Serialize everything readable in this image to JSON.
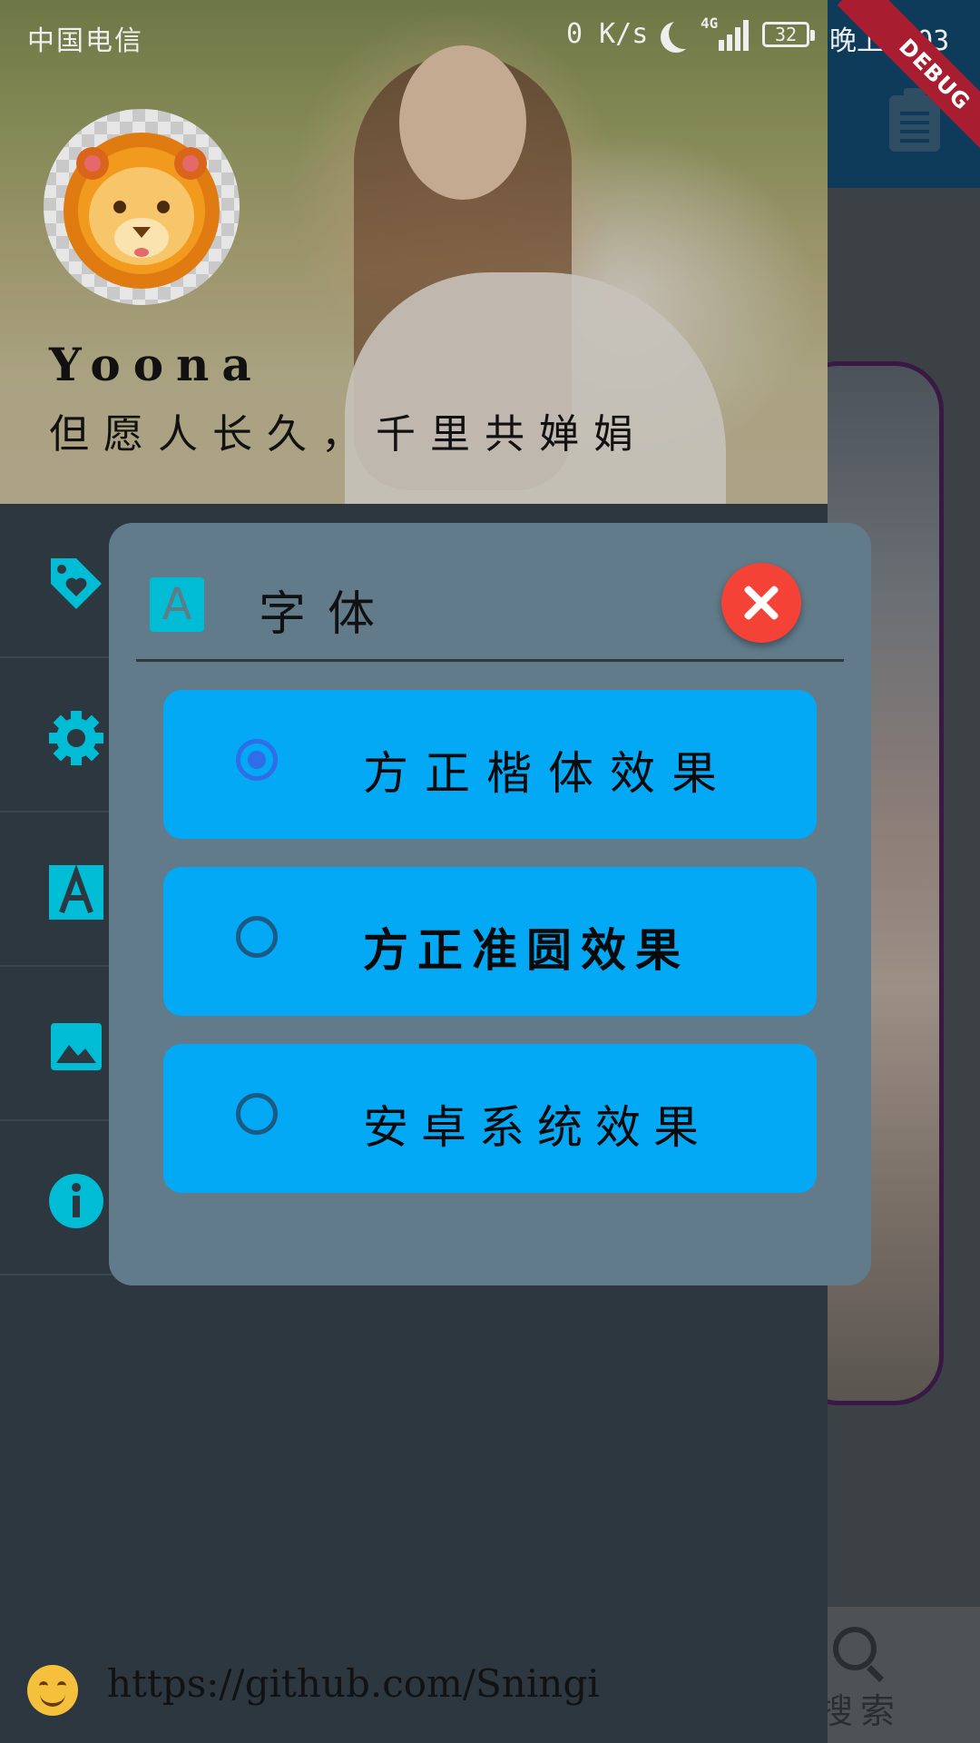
{
  "status_bar": {
    "carrier": "中国电信",
    "net_speed": "0 K/s",
    "network_type": "4G",
    "battery": "32",
    "time": "晚上8:03"
  },
  "debug_banner": "DEBUG",
  "background_page": {
    "search_label": "搜索"
  },
  "drawer": {
    "user": {
      "name": "Yoona",
      "motto": "但愿人长久，千里共婵娟"
    },
    "menu_icons": [
      "tag-heart-icon",
      "gear-icon",
      "font-icon",
      "image-icon",
      "info-icon"
    ],
    "footer": {
      "emoji": "😊",
      "link": "https://github.com/Sningi"
    }
  },
  "dialog": {
    "icon_glyph": "A",
    "title": "字体",
    "options": [
      {
        "label": "方正楷体效果",
        "selected": true
      },
      {
        "label": "方正准圆效果",
        "selected": false
      },
      {
        "label": "安卓系统效果",
        "selected": false
      }
    ]
  },
  "colors": {
    "accent": "#00bcd4",
    "option_bg": "#03a9f4",
    "close": "#f44336",
    "dialog_bg": "#617b8a",
    "drawer_bg": "#2d3740"
  }
}
